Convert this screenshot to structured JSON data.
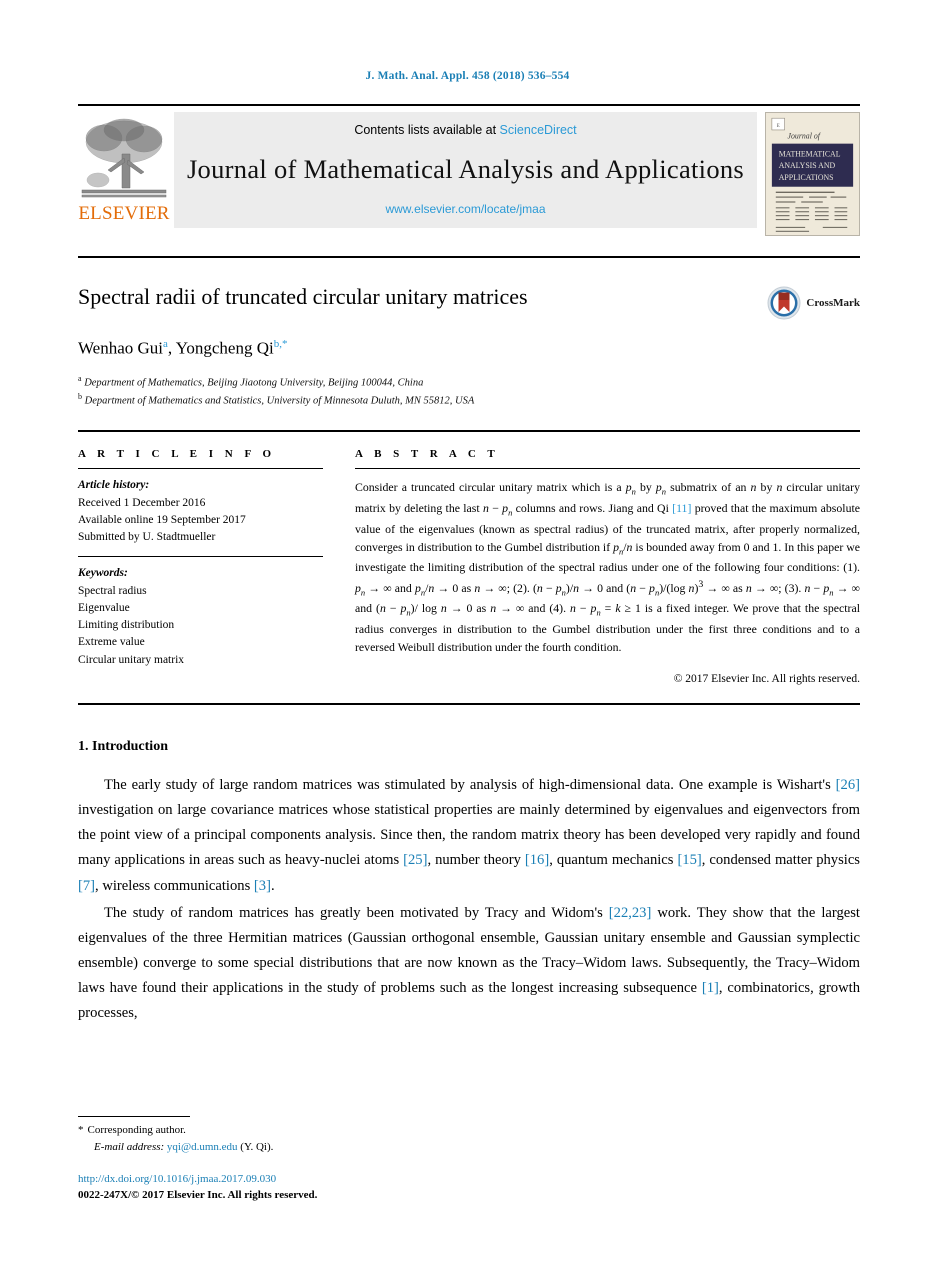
{
  "running_head": "J. Math. Anal. Appl. 458 (2018) 536–554",
  "masthead": {
    "publisher": "ELSEVIER",
    "contents_prefix": "Contents lists available at ",
    "contents_link": "ScienceDirect",
    "journal_title": "Journal of Mathematical Analysis and Applications",
    "journal_url": "www.elsevier.com/locate/jmaa",
    "cover_lines": [
      "Journal of",
      "MATHEMATICAL",
      "ANALYSIS AND",
      "APPLICATIONS"
    ],
    "link_color": "#2b9ad6",
    "elsevier_color": "#e36c09"
  },
  "article": {
    "title": "Spectral radii of truncated circular unitary matrices",
    "crossmark_label": "CrossMark",
    "authors_html": "Wenhao Gui<sup>a</sup>, Yongcheng Qi<sup>b,*</sup>",
    "affiliations": [
      {
        "marker": "a",
        "text": "Department of Mathematics, Beijing Jiaotong University, Beijing 100044, China"
      },
      {
        "marker": "b",
        "text": "Department of Mathematics and Statistics, University of Minnesota Duluth, MN 55812, USA"
      }
    ]
  },
  "article_info": {
    "heading": "A R T I C L E    I N F O",
    "history_label": "Article history:",
    "history": [
      "Received 1 December 2016",
      "Available online 19 September 2017",
      "Submitted by U. Stadtmueller"
    ],
    "keywords_label": "Keywords:",
    "keywords": [
      "Spectral radius",
      "Eigenvalue",
      "Limiting distribution",
      "Extreme value",
      "Circular unitary matrix"
    ]
  },
  "abstract": {
    "heading": "A B S T R A C T",
    "text_html": "Consider a truncated circular unitary matrix which is a <i>p<sub>n</sub></i> by <i>p<sub>n</sub></i> submatrix of an <i>n</i> by <i>n</i> circular unitary matrix by deleting the last <i>n</i> − <i>p<sub>n</sub></i> columns and rows. Jiang and Qi <span class=\"ref\">[11]</span> proved that the maximum absolute value of the eigenvalues (known as spectral radius) of the truncated matrix, after properly normalized, converges in distribution to the Gumbel distribution if <i>p<sub>n</sub></i>/<i>n</i> is bounded away from 0 and 1. In this paper we investigate the limiting distribution of the spectral radius under one of the following four conditions: (1). <i>p<sub>n</sub></i> → ∞ and <i>p<sub>n</sub></i>/<i>n</i> → 0 as <i>n</i> → ∞; (2). (<i>n</i> − <i>p<sub>n</sub></i>)/<i>n</i> → 0 and (<i>n</i> − <i>p<sub>n</sub></i>)/(log <i>n</i>)<sup>3</sup> → ∞ as <i>n</i> → ∞; (3). <i>n</i> − <i>p<sub>n</sub></i> → ∞ and (<i>n</i> − <i>p<sub>n</sub></i>)/ log <i>n</i> → 0 as <i>n</i> → ∞ and (4). <i>n</i> − <i>p<sub>n</sub></i> = <i>k</i> ≥ 1 is a fixed integer. We prove that the spectral radius converges in distribution to the Gumbel distribution under the first three conditions and to a reversed Weibull distribution under the fourth condition.",
    "copyright": "© 2017 Elsevier Inc. All rights reserved."
  },
  "body": {
    "section_title": "1. Introduction",
    "paragraphs_html": [
      "The early study of large random matrices was stimulated by analysis of high-dimensional data. One example is Wishart's <span class=\"ref\">[26]</span> investigation on large covariance matrices whose statistical properties are mainly determined by eigenvalues and eigenvectors from the point view of a principal components analysis. Since then, the random matrix theory has been developed very rapidly and found many applications in areas such as heavy-nuclei atoms <span class=\"ref\">[25]</span>, number theory <span class=\"ref\">[16]</span>, quantum mechanics <span class=\"ref\">[15]</span>, condensed matter physics <span class=\"ref\">[7]</span>, wireless communications <span class=\"ref\">[3]</span>.",
      "The study of random matrices has greatly been motivated by Tracy and Widom's <span class=\"ref\">[22,23]</span> work. They show that the largest eigenvalues of the three Hermitian matrices (Gaussian orthogonal ensemble, Gaussian unitary ensemble and Gaussian symplectic ensemble) converge to some special distributions that are now known as the Tracy–Widom laws. Subsequently, the Tracy–Widom laws have found their applications in the study of problems such as the longest increasing subsequence <span class=\"ref\">[1]</span>, combinatorics, growth processes,"
    ]
  },
  "footer": {
    "corresponding_marker": "*",
    "corresponding_text": "Corresponding author.",
    "email_label": "E-mail address:",
    "email": "yqi@d.umn.edu",
    "email_suffix": "(Y. Qi).",
    "doi": "http://dx.doi.org/10.1016/j.jmaa.2017.09.030",
    "issn_line": "0022-247X/© 2017 Elsevier Inc. All rights reserved."
  }
}
